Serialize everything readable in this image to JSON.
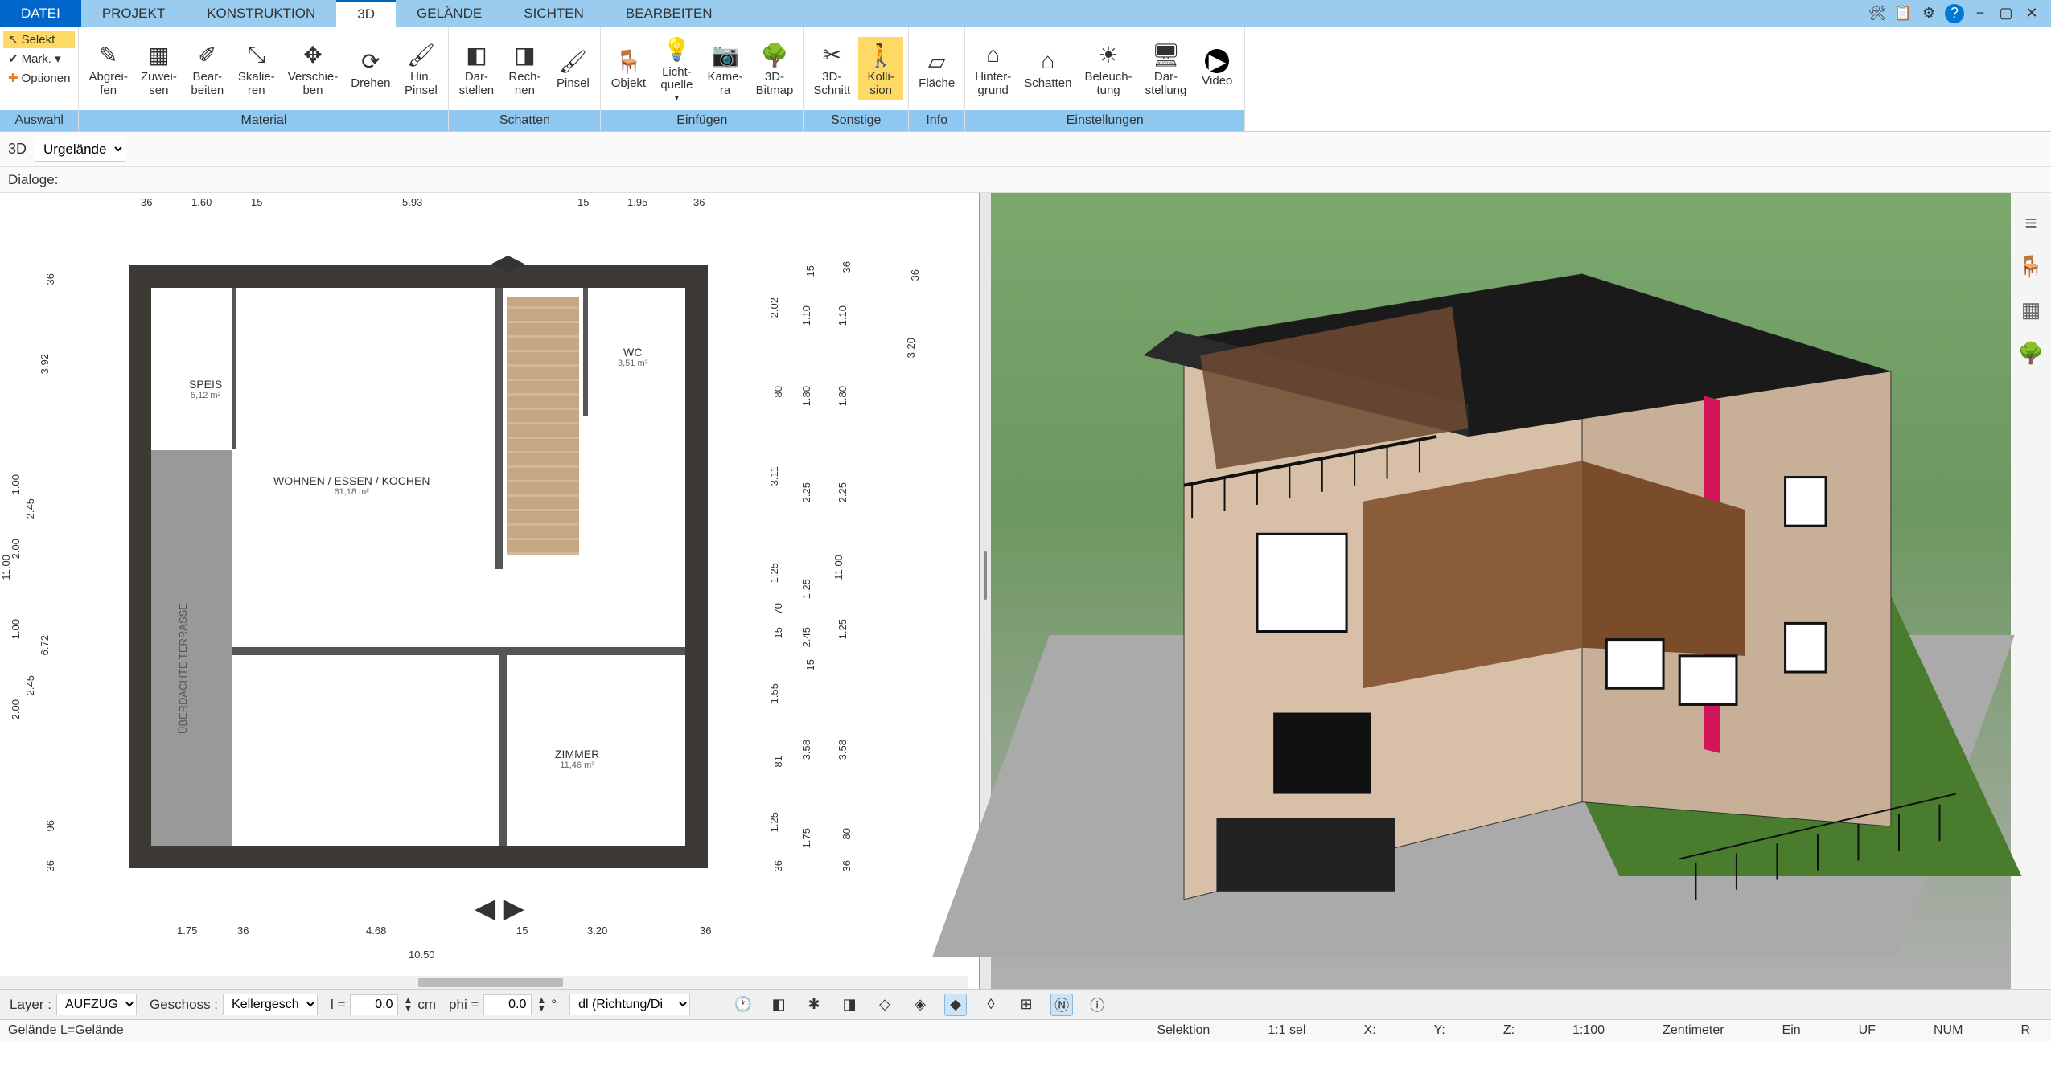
{
  "tabs": {
    "datei": "DATEI",
    "projekt": "PROJEKT",
    "konstruktion": "KONSTRUKTION",
    "d3": "3D",
    "gelaende": "GELÄNDE",
    "sichten": "SICHTEN",
    "bearbeiten": "BEARBEITEN"
  },
  "ribbon": {
    "auswahl": {
      "label": "Auswahl",
      "selekt": "Selekt",
      "mark": "Mark.",
      "optionen": "Optionen"
    },
    "material": {
      "label": "Material",
      "abgreifen": "Abgrei-\nfen",
      "zuweisen": "Zuwei-\nsen",
      "bearbeiten": "Bear-\nbeiten",
      "skalieren": "Skalie-\nren",
      "verschieben": "Verschie-\nben",
      "drehen": "Drehen",
      "hinpinsel": "Hin.\nPinsel"
    },
    "schatten": {
      "label": "Schatten",
      "darstellen": "Dar-\nstellen",
      "rechnen": "Rech-\nnen",
      "pinsel": "Pinsel"
    },
    "einfuegen": {
      "label": "Einfügen",
      "objekt": "Objekt",
      "lichtquelle": "Licht-\nquelle",
      "kamera": "Kame-\nra",
      "bitmap3d": "3D-\nBitmap"
    },
    "sonstige": {
      "label": "Sonstige",
      "schnitt3d": "3D-\nSchnitt",
      "kollision": "Kolli-\nsion"
    },
    "info": {
      "label": "Info",
      "flaeche": "Fläche"
    },
    "einstellungen": {
      "label": "Einstellungen",
      "hintergrund": "Hinter-\ngrund",
      "schatten": "Schatten",
      "beleuchtung": "Beleuch-\ntung",
      "darstellung": "Dar-\nstellung",
      "video": "Video"
    }
  },
  "subToolbar": {
    "d3": "3D",
    "select_value": "Urgelände"
  },
  "dialoge": "Dialoge:",
  "floorplan": {
    "rooms": {
      "speis": {
        "name": "SPEIS",
        "area": "5,12 m²"
      },
      "wohnen": {
        "name": "WOHNEN / ESSEN / KOCHEN",
        "area": "61,18 m²"
      },
      "wc": {
        "name": "WC",
        "area": "3,51 m²"
      },
      "zimmer": {
        "name": "ZIMMER",
        "area": "11,46 m²"
      }
    },
    "terrace": "ÜBERDACHTE TERRASSE",
    "dims": {
      "top": {
        "d1": "36",
        "d2": "1.60",
        "d3": "15",
        "d4": "5.93",
        "d5": "15",
        "d6": "1.95",
        "d7": "36"
      },
      "bottom": {
        "d1": "1.75",
        "d2": "36",
        "d3": "4.68",
        "d4": "15",
        "d5": "3.20",
        "d6": "36",
        "total": "10.50"
      },
      "left": {
        "d1": "36",
        "d2": "3.92",
        "d3": "6.72",
        "d4": "96",
        "d5": "36"
      },
      "left2": {
        "d1": "1.00",
        "d2": "2.00",
        "d3": "1.00",
        "d4": "2.00",
        "total": "11.00"
      },
      "left3": {
        "d1": "2.45",
        "d2": "2.45"
      },
      "right_cols": {
        "c1": {
          "v1": "2.02",
          "v2": "80",
          "v3": "3.11",
          "v4": "1.25",
          "v5": "70",
          "v6": "15",
          "v7": "1.55",
          "v8": "81",
          "v9": "1.25",
          "v10": "36"
        },
        "c2": {
          "v1": "15",
          "v2": "1.10",
          "v3": "1.80",
          "v4": "2.25",
          "v5": "1.25",
          "v6": "2.45",
          "v7": "15",
          "v8": "3.58",
          "v9": "1.75"
        },
        "c3": {
          "v1": "36",
          "v2": "1.10",
          "v3": "1.80",
          "v4": "2.25",
          "v5": "11.00",
          "v6": "1.25",
          "v7": "3.58",
          "v8": "80",
          "v9": "36"
        },
        "c4": {
          "v1": "36",
          "v2": "3.20"
        }
      }
    }
  },
  "bottomToolbar": {
    "layer_label": "Layer :",
    "layer_value": "AUFZUG",
    "geschoss_label": "Geschoss :",
    "geschoss_value": "Kellergesch",
    "l_label": "l =",
    "l_value": "0.0",
    "cm": "cm",
    "phi_label": "phi =",
    "phi_value": "0.0",
    "deg": "°",
    "mode_value": "dl (Richtung/Di"
  },
  "statusBar": {
    "left": "Gelände L=Gelände",
    "selektion": "Selektion",
    "ratio": "1:1 sel",
    "x": "X:",
    "y": "Y:",
    "z": "Z:",
    "scale": "1:100",
    "unit": "Zentimeter",
    "ein": "Ein",
    "uf": "UF",
    "num": "NUM",
    "r": "R"
  }
}
